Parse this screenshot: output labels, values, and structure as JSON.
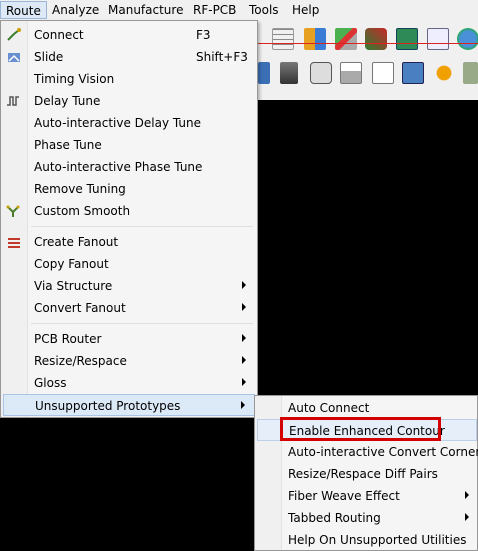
{
  "menubar": {
    "items": [
      "Route",
      "Analyze",
      "Manufacture",
      "RF-PCB",
      "Tools",
      "Help"
    ]
  },
  "route_menu": {
    "items": [
      {
        "label": "Connect",
        "shortcut": "F3",
        "icon": "connect-icon"
      },
      {
        "label": "Slide",
        "shortcut": "Shift+F3",
        "icon": "slide-icon"
      },
      {
        "label": "Timing Vision"
      },
      {
        "label": "Delay Tune",
        "icon": "delay-tune-icon"
      },
      {
        "label": "Auto-interactive Delay Tune"
      },
      {
        "label": "Phase Tune"
      },
      {
        "label": "Auto-interactive Phase Tune"
      },
      {
        "label": "Remove Tuning"
      },
      {
        "label": "Custom Smooth",
        "icon": "custom-smooth-icon"
      },
      {
        "label": "Create Fanout",
        "icon": "fanout-icon"
      },
      {
        "label": "Copy Fanout"
      },
      {
        "label": "Via Structure",
        "submenu": true
      },
      {
        "label": "Convert Fanout",
        "submenu": true
      },
      {
        "label": "PCB Router",
        "submenu": true
      },
      {
        "label": "Resize/Respace",
        "submenu": true
      },
      {
        "label": "Gloss",
        "submenu": true
      },
      {
        "label": "Unsupported Prototypes",
        "submenu": true,
        "highlighted": true
      }
    ]
  },
  "sub_menu": {
    "items": [
      {
        "label": "Auto Connect"
      },
      {
        "label": "Enable Enhanced Contour",
        "highlighted": true
      },
      {
        "label": "Auto-interactive Convert Corner"
      },
      {
        "label": "Resize/Respace Diff Pairs"
      },
      {
        "label": "Fiber Weave Effect",
        "submenu": true
      },
      {
        "label": "Tabbed Routing",
        "submenu": true
      },
      {
        "label": "Help On Unsupported Utilities"
      }
    ]
  },
  "colors": {
    "menu_bg": "#f5f5f5",
    "highlight": "#dce9f7",
    "annotation_red": "#d40000",
    "canvas": "#000000"
  }
}
